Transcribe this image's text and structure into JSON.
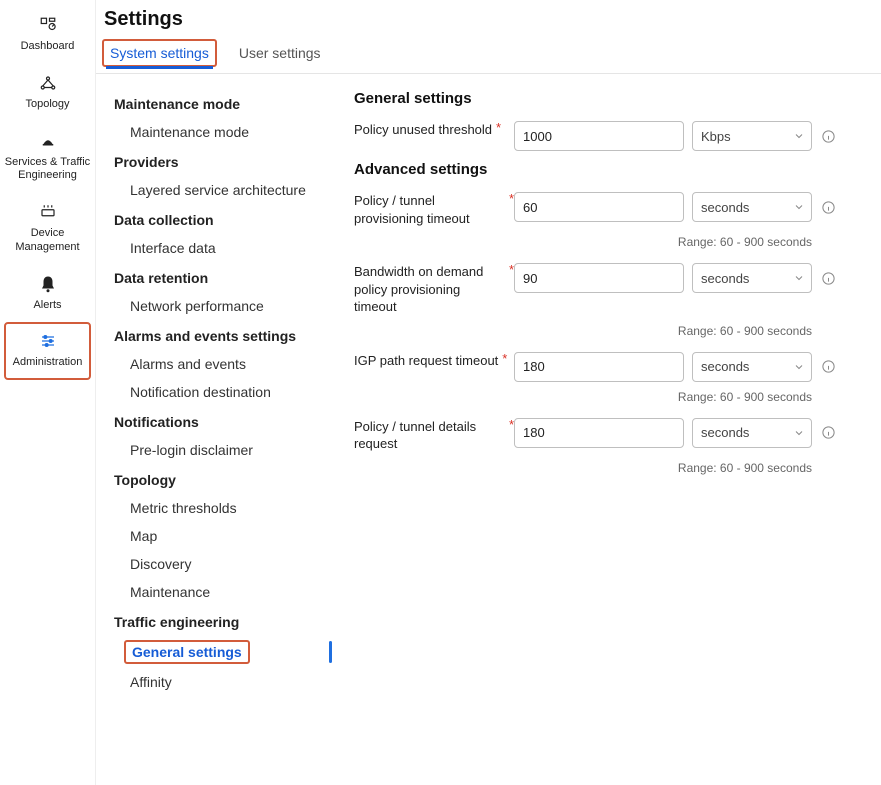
{
  "rail": {
    "dashboard": "Dashboard",
    "topology": "Topology",
    "services": "Services & Traffic Engineering",
    "device": "Device Management",
    "alerts": "Alerts",
    "admin": "Administration"
  },
  "page_title": "Settings",
  "tabs": {
    "system": "System settings",
    "user": "User settings"
  },
  "sidenav": {
    "maintenance_mode_h": "Maintenance mode",
    "maintenance_mode": "Maintenance mode",
    "providers_h": "Providers",
    "layered_service": "Layered service architecture",
    "data_collection_h": "Data collection",
    "interface_data": "Interface data",
    "data_retention_h": "Data retention",
    "network_performance": "Network performance",
    "alarms_events_h": "Alarms and events settings",
    "alarms_events": "Alarms and events",
    "notification_dest": "Notification destination",
    "notifications_h": "Notifications",
    "prelogin": "Pre-login disclaimer",
    "topology_h": "Topology",
    "metric_thresholds": "Metric thresholds",
    "map": "Map",
    "discovery": "Discovery",
    "maintenance": "Maintenance",
    "traffic_eng_h": "Traffic engineering",
    "general_settings": "General settings",
    "affinity": "Affinity"
  },
  "form": {
    "general_title": "General settings",
    "advanced_title": "Advanced settings",
    "policy_unused_threshold": {
      "label": "Policy unused threshold",
      "value": "1000",
      "unit": "Kbps"
    },
    "provisioning_timeout": {
      "label": "Policy / tunnel provisioning timeout",
      "value": "60",
      "unit": "seconds",
      "hint": "Range: 60 - 900 seconds"
    },
    "bod_timeout": {
      "label": "Bandwidth on demand policy provisioning timeout",
      "value": "90",
      "unit": "seconds",
      "hint": "Range: 60 - 900 seconds"
    },
    "igp_timeout": {
      "label": "IGP path request timeout",
      "value": "180",
      "unit": "seconds",
      "hint": "Range: 60 - 900 seconds"
    },
    "details_request": {
      "label": "Policy / tunnel details request",
      "value": "180",
      "unit": "seconds",
      "hint": "Range: 60 - 900 seconds"
    }
  }
}
